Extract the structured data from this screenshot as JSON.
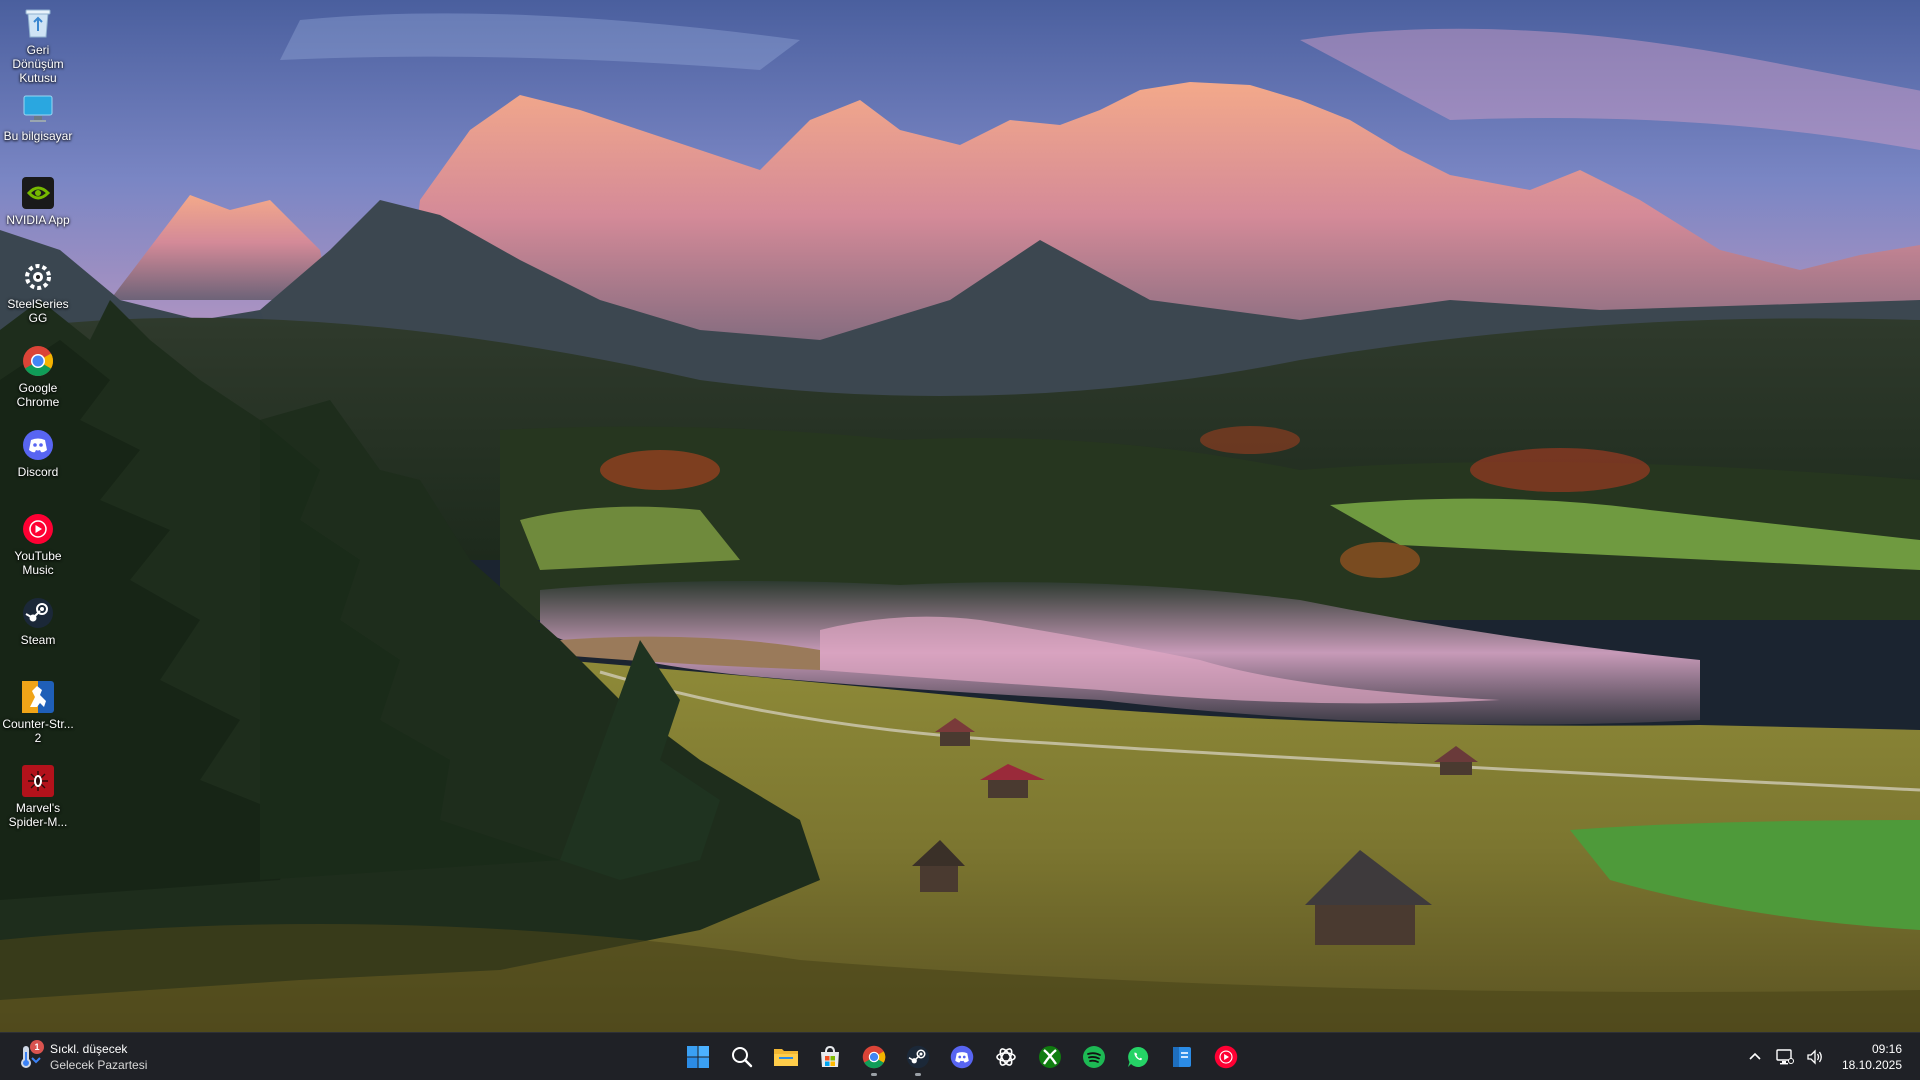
{
  "desktop": {
    "icons": [
      {
        "label": "Geri Dönüşüm Kutusu",
        "icon": "recycle-bin-icon"
      },
      {
        "label": "Bu bilgisayar",
        "icon": "computer-icon"
      },
      {
        "label": "NVIDIA App",
        "icon": "nvidia-icon"
      },
      {
        "label": "SteelSeries GG",
        "icon": "steelseries-icon"
      },
      {
        "label": "Google Chrome",
        "icon": "chrome-icon"
      },
      {
        "label": "Discord",
        "icon": "discord-icon"
      },
      {
        "label": "YouTube Music",
        "icon": "youtube-music-icon"
      },
      {
        "label": "Steam",
        "icon": "steam-icon"
      },
      {
        "label": "Counter-Str... 2",
        "icon": "counter-strike-icon"
      },
      {
        "label": "Marvel's Spider-M...",
        "icon": "spider-man-icon"
      }
    ]
  },
  "taskbar": {
    "weather": {
      "title": "Sıckl. düşecek",
      "subtitle": "Gelecek Pazartesi",
      "badge": "1",
      "icon": "weather-thermometer-icon"
    },
    "pinned": [
      {
        "name": "start",
        "icon": "windows-start-icon",
        "running": false
      },
      {
        "name": "search",
        "icon": "search-icon",
        "running": false
      },
      {
        "name": "file-explorer",
        "icon": "folder-icon",
        "running": false
      },
      {
        "name": "microsoft-store",
        "icon": "store-icon",
        "running": false
      },
      {
        "name": "chrome",
        "icon": "chrome-icon",
        "running": true
      },
      {
        "name": "steam",
        "icon": "steam-icon",
        "running": true
      },
      {
        "name": "discord",
        "icon": "discord-icon",
        "running": false
      },
      {
        "name": "chatgpt",
        "icon": "chatgpt-icon",
        "running": false
      },
      {
        "name": "xbox",
        "icon": "xbox-icon",
        "running": false
      },
      {
        "name": "spotify",
        "icon": "spotify-icon",
        "running": false
      },
      {
        "name": "whatsapp",
        "icon": "whatsapp-icon",
        "running": false
      },
      {
        "name": "notes",
        "icon": "notes-icon",
        "running": false
      },
      {
        "name": "youtube-music",
        "icon": "youtube-music-icon",
        "running": false
      }
    ],
    "tray": {
      "icons": [
        "chevron-up-icon",
        "network-icon",
        "volume-icon"
      ],
      "time": "09:16",
      "date": "18.10.2025"
    }
  },
  "colors": {
    "taskbar_bg": "#1f2126",
    "chrome_red": "#db4437",
    "chrome_yellow": "#f4b400",
    "chrome_green": "#0f9d58",
    "chrome_blue": "#4285f4",
    "discord": "#5865f2",
    "steam": "#1b2838",
    "spotify": "#1db954",
    "whatsapp": "#25d366",
    "xbox": "#107c10",
    "ytmusic": "#ff0033",
    "nvidia": "#76b900"
  }
}
